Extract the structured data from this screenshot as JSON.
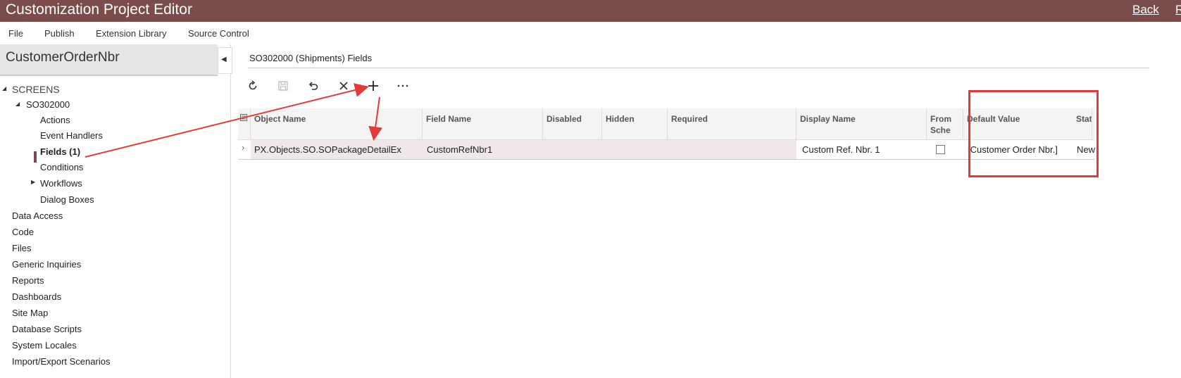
{
  "app": {
    "title": "Customization Project Editor",
    "back_label": "Back",
    "clip_label": "R"
  },
  "menu": {
    "items": [
      "File",
      "Publish",
      "Extension Library",
      "Source Control"
    ]
  },
  "sidebar": {
    "project_name": "CustomerOrderNbr",
    "tree": [
      "SCREENS",
      "SO302000",
      "Actions",
      "Event Handlers",
      "Fields (1)",
      "Conditions",
      "Workflows",
      "Dialog Boxes",
      "Data Access",
      "Code",
      "Files",
      "Generic Inquiries",
      "Reports",
      "Dashboards",
      "Site Map",
      "Database Scripts",
      "System Locales",
      "Import/Export Scenarios"
    ]
  },
  "main": {
    "section_title": "SO302000 (Shipments) Fields",
    "toolbar": {
      "icons": [
        "refresh-icon",
        "save-icon",
        "undo-icon",
        "delete-icon",
        "add-icon",
        "more-icon"
      ]
    },
    "grid": {
      "columns": [
        "Object Name",
        "Field Name",
        "Disabled",
        "Hidden",
        "Required",
        "Display Name",
        "From Sche",
        "Default Value",
        "Stat"
      ],
      "rows": [
        {
          "object_name": "PX.Objects.SO.SOPackageDetailEx",
          "field_name": "CustomRefNbr1",
          "disabled": "",
          "hidden": "",
          "required": "",
          "display_name": "Custom Ref. Nbr. 1",
          "from_schema": false,
          "default_value": "[Customer Order Nbr.]",
          "status": "New"
        }
      ]
    }
  },
  "colors": {
    "accent": "#7a4c4c",
    "annotation": "#e23a3a"
  }
}
